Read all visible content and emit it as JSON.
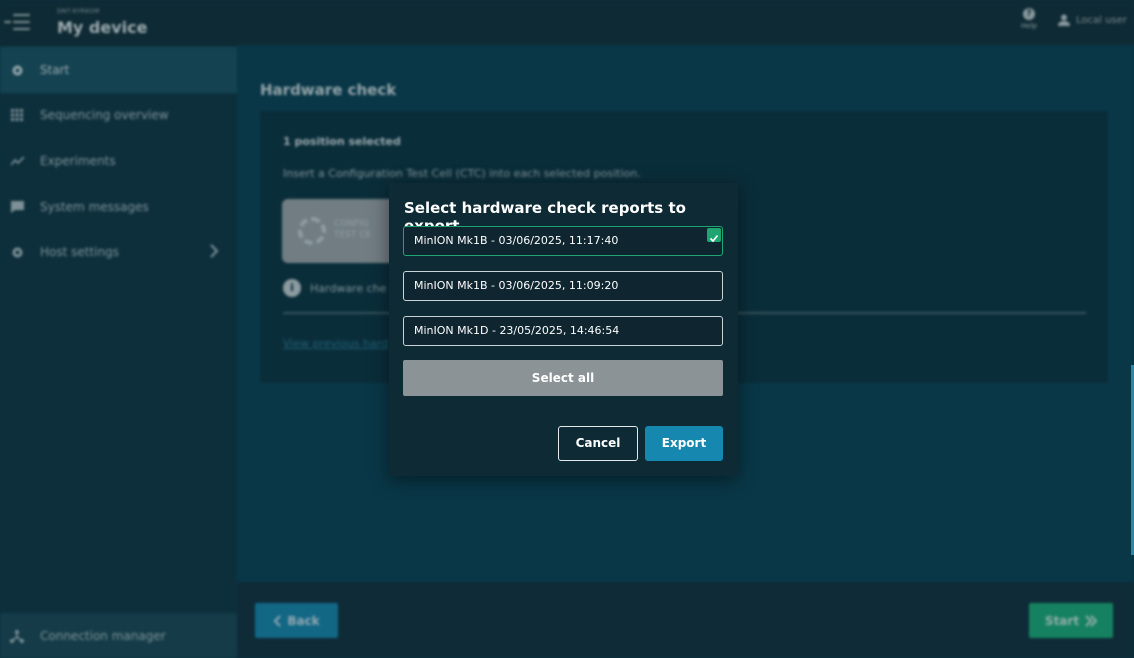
{
  "topbar": {
    "device_id": "DNT-6YRKOM",
    "device_title": "My device",
    "help_label": "Help",
    "user_label": "Local user"
  },
  "sidebar": {
    "items": [
      {
        "label": "Start",
        "icon": "gear-icon"
      },
      {
        "label": "Sequencing overview",
        "icon": "grid-icon"
      },
      {
        "label": "Experiments",
        "icon": "trend-icon"
      },
      {
        "label": "System messages",
        "icon": "message-icon"
      },
      {
        "label": "Host settings",
        "icon": "settings-icon"
      }
    ],
    "connection_manager": "Connection manager"
  },
  "main": {
    "title": "Hardware check",
    "card": {
      "heading": "1 position selected",
      "instruction": "Insert a Configuration Test Cell (CTC) into each selected position.",
      "ctc_label_line1": "CONFIG",
      "ctc_label_line2": "TEST CE",
      "info_text": "Hardware che",
      "link_text": "View previous hard"
    }
  },
  "footer": {
    "back_label": "Back",
    "start_label": "Start"
  },
  "modal": {
    "title": "Select hardware check reports to export",
    "reports": [
      {
        "label": "MinION Mk1B - 03/06/2025, 11:17:40",
        "checked": true
      },
      {
        "label": "MinION Mk1B - 03/06/2025, 11:09:20",
        "checked": false
      },
      {
        "label": "MinION Mk1D - 23/05/2025, 14:46:54",
        "checked": false
      }
    ],
    "select_all_label": "Select all",
    "cancel_label": "Cancel",
    "export_label": "Export"
  },
  "colors": {
    "accent_blue": "#1688b0",
    "accent_green": "#1fa572",
    "modal_bg": "#0d2a35"
  }
}
